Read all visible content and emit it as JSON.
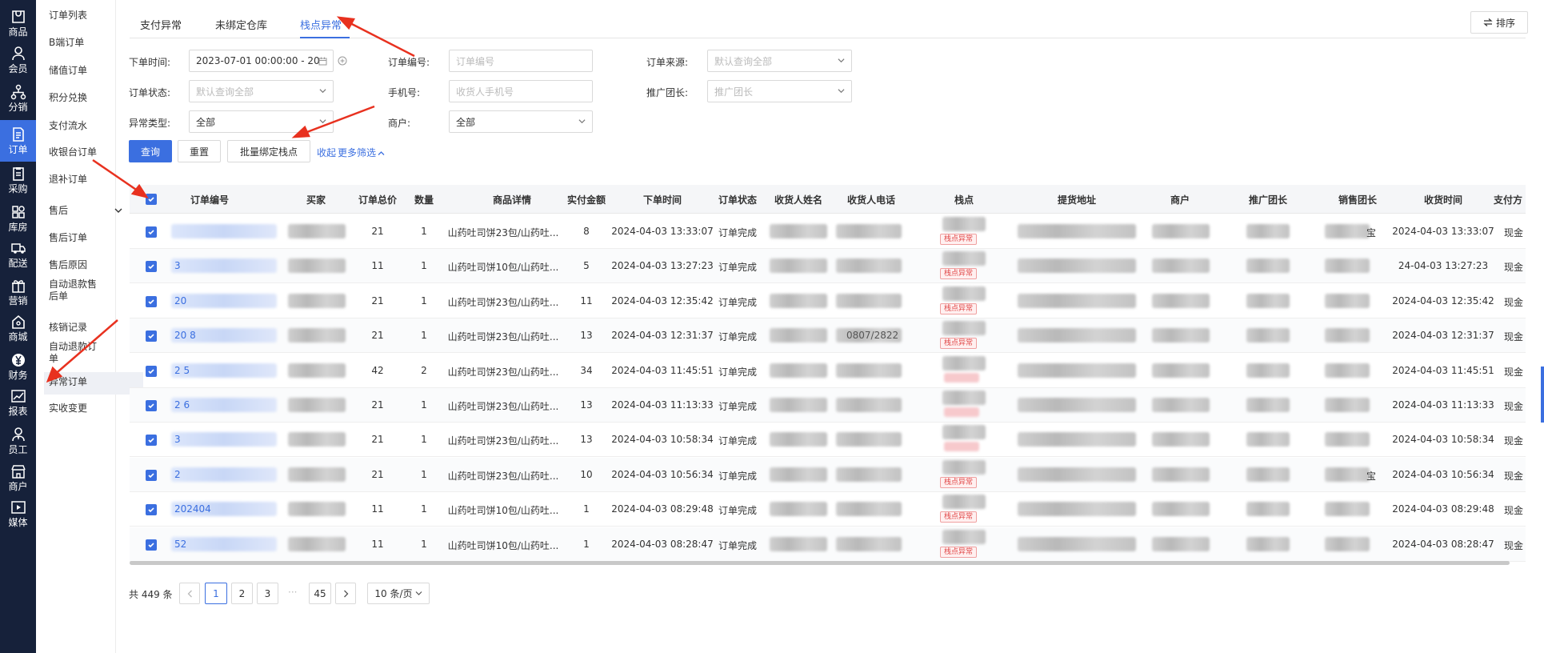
{
  "rail": [
    {
      "label": "商品",
      "icon": "bag-icon"
    },
    {
      "label": "会员",
      "icon": "user-icon"
    },
    {
      "label": "分销",
      "icon": "network-icon"
    },
    {
      "label": "订单",
      "icon": "document-icon",
      "active": true
    },
    {
      "label": "采购",
      "icon": "clipboard-icon"
    },
    {
      "label": "库房",
      "icon": "grid-icon"
    },
    {
      "label": "配送",
      "icon": "truck-icon"
    },
    {
      "label": "营销",
      "icon": "gift-icon"
    },
    {
      "label": "商城",
      "icon": "home-icon"
    },
    {
      "label": "财务",
      "icon": "yen-icon"
    },
    {
      "label": "报表",
      "icon": "chart-icon"
    },
    {
      "label": "员工",
      "icon": "staff-icon"
    },
    {
      "label": "商户",
      "icon": "shop-icon"
    },
    {
      "label": "媒体",
      "icon": "play-icon"
    }
  ],
  "submenu": {
    "items": [
      "订单列表",
      "B端订单",
      "储值订单",
      "积分兑换",
      "支付流水",
      "收银台订单",
      "退补订单"
    ],
    "group": "售后",
    "group_items": [
      "售后订单",
      "售后原因"
    ],
    "auto_refund_after": [
      "自动退款售",
      "后单"
    ],
    "items2": [
      "核销记录"
    ],
    "auto_refund": [
      "自动退款订",
      "单"
    ],
    "items3": [
      "异常订单",
      "实收变更"
    ]
  },
  "tabs": [
    "支付异常",
    "未绑定仓库",
    "栈点异常"
  ],
  "sort_label": "排序",
  "filters": {
    "order_time_label": "下单时间:",
    "order_time_value": "2023-07-01 00:00:00 - 20",
    "order_no_label": "订单编号:",
    "order_no_placeholder": "订单编号",
    "order_source_label": "订单来源:",
    "order_source_placeholder": "默认查询全部",
    "order_status_label": "订单状态:",
    "order_status_placeholder": "默认查询全部",
    "phone_label": "手机号:",
    "phone_placeholder": "收货人手机号",
    "team_label": "推广团长:",
    "team_placeholder": "推广团长",
    "exception_label": "异常类型:",
    "exception_value": "全部",
    "merchant_label": "商户:",
    "merchant_value": "全部"
  },
  "actions": {
    "query": "查询",
    "reset": "重置",
    "bind": "批量绑定栈点",
    "collapse": "收起",
    "more": "更多筛选"
  },
  "columns": [
    "订单编号",
    "买家",
    "订单总价",
    "数量",
    "商品详情",
    "实付金额",
    "下单时间",
    "订单状态",
    "收货人姓名",
    "收货人电话",
    "栈点",
    "提货地址",
    "商户",
    "推广团长",
    "销售团长",
    "收货时间",
    "支付方"
  ],
  "rows": [
    {
      "no": "",
      "total": "21",
      "qty": "1",
      "detail": "山药吐司饼23包/山药吐...",
      "paid": "8",
      "time": "2024-04-03 13:33:07",
      "status": "订单完成",
      "phone": "",
      "tag": "栈点异常",
      "seller": "宝",
      "recv": "2024-04-03 13:33:07",
      "pay": "现金"
    },
    {
      "no": "3",
      "total": "11",
      "qty": "1",
      "detail": "山药吐司饼10包/山药吐...",
      "paid": "5",
      "time": "2024-04-03 13:27:23",
      "status": "订单完成",
      "phone": "",
      "tag": "栈点异常",
      "seller": "",
      "recv": "24-04-03 13:27:23",
      "pay": "现金"
    },
    {
      "no": "20",
      "total": "21",
      "qty": "1",
      "detail": "山药吐司饼23包/山药吐...",
      "paid": "11",
      "time": "2024-04-03 12:35:42",
      "status": "订单完成",
      "phone": "",
      "tag": "栈点异常",
      "seller": "",
      "recv": "2024-04-03 12:35:42",
      "pay": "现金"
    },
    {
      "no": "20 8",
      "total": "21",
      "qty": "1",
      "detail": "山药吐司饼23包/山药吐...",
      "paid": "13",
      "time": "2024-04-03 12:31:37",
      "status": "订单完成",
      "phone": "0807/2822",
      "tag": "栈点异常",
      "seller": "",
      "recv": "2024-04-03 12:31:37",
      "pay": "现金"
    },
    {
      "no": "2 5",
      "total": "42",
      "qty": "2",
      "detail": "山药吐司饼23包/山药吐...",
      "paid": "34",
      "time": "2024-04-03 11:45:51",
      "status": "订单完成",
      "phone": "",
      "tag": "",
      "seller": "",
      "recv": "2024-04-03 11:45:51",
      "pay": "现金"
    },
    {
      "no": "2 6",
      "total": "21",
      "qty": "1",
      "detail": "山药吐司饼23包/山药吐...",
      "paid": "13",
      "time": "2024-04-03 11:13:33",
      "status": "订单完成",
      "phone": "",
      "tag": "",
      "seller": "",
      "recv": "2024-04-03 11:13:33",
      "pay": "现金"
    },
    {
      "no": "3",
      "total": "21",
      "qty": "1",
      "detail": "山药吐司饼23包/山药吐...",
      "paid": "13",
      "time": "2024-04-03 10:58:34",
      "status": "订单完成",
      "phone": "",
      "tag": "",
      "seller": "",
      "recv": "2024-04-03 10:58:34",
      "pay": "现金"
    },
    {
      "no": "2",
      "total": "21",
      "qty": "1",
      "detail": "山药吐司饼23包/山药吐...",
      "paid": "10",
      "time": "2024-04-03 10:56:34",
      "status": "订单完成",
      "phone": "",
      "tag": "栈点异常",
      "seller": "宝",
      "recv": "2024-04-03 10:56:34",
      "pay": "现金"
    },
    {
      "no": "202404",
      "total": "11",
      "qty": "1",
      "detail": "山药吐司饼10包/山药吐...",
      "paid": "1",
      "time": "2024-04-03 08:29:48",
      "status": "订单完成",
      "phone": "",
      "tag": "栈点异常",
      "seller": "",
      "recv": "2024-04-03 08:29:48",
      "pay": "现金"
    },
    {
      "no": "52",
      "total": "11",
      "qty": "1",
      "detail": "山药吐司饼10包/山药吐...",
      "paid": "1",
      "time": "2024-04-03 08:28:47",
      "status": "订单完成",
      "phone": "",
      "tag": "栈点异常",
      "seller": "",
      "recv": "2024-04-03 08:28:47",
      "pay": "现金"
    }
  ],
  "pagination": {
    "total": "共 449 条",
    "pages": [
      "1",
      "2",
      "3"
    ],
    "ellipsis": "···",
    "last": "45",
    "size": "10 条/页"
  },
  "colors": {
    "accent": "#3b6fe0",
    "rail_bg": "#16213a",
    "tag_red": "#e04a4a",
    "arrow": "#e8311f"
  }
}
